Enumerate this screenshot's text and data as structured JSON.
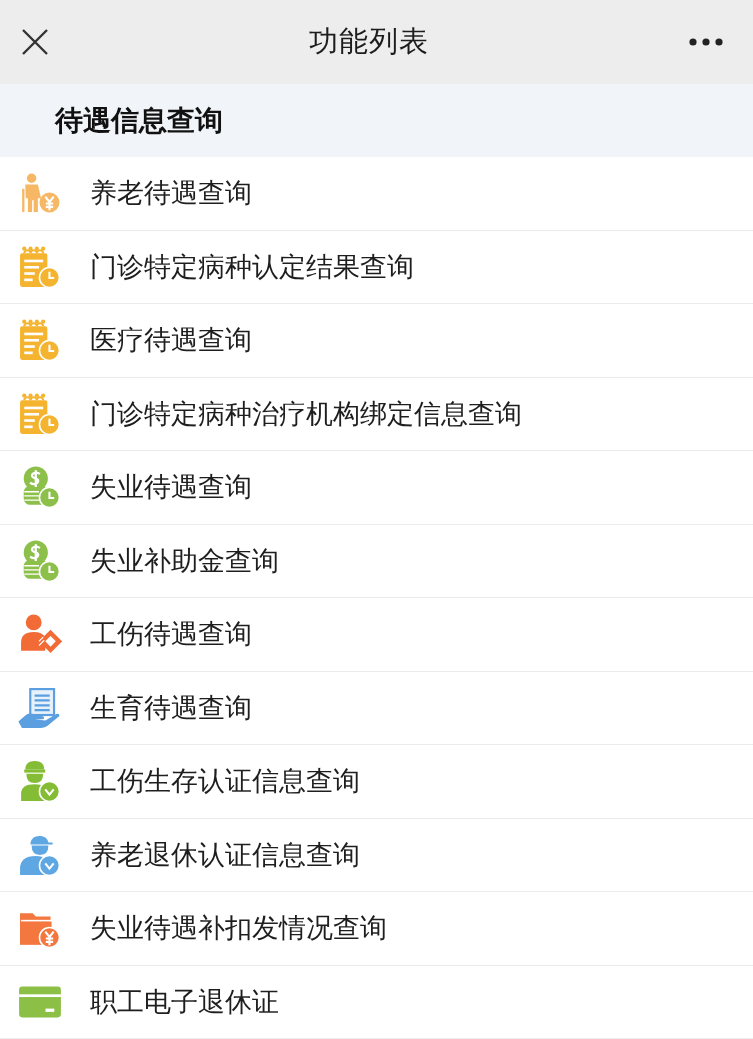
{
  "header": {
    "title": "功能列表"
  },
  "section": {
    "title": "待遇信息查询",
    "items": [
      "养老待遇查询",
      "门诊特定病种认定结果查询",
      "医疗待遇查询",
      "门诊特定病种治疗机构绑定信息查询",
      "失业待遇查询",
      "失业补助金查询",
      "工伤待遇查询",
      "生育待遇查询",
      "工伤生存认证信息查询",
      "养老退休认证信息查询",
      "失业待遇补扣发情况查询",
      "职工电子退休证"
    ]
  }
}
